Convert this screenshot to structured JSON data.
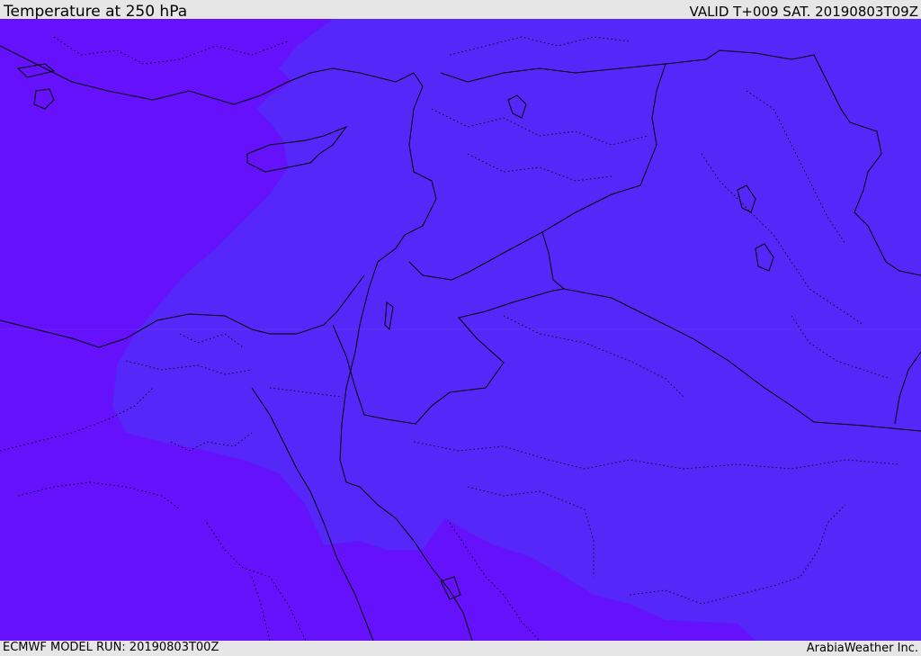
{
  "header": {
    "title": "Temperature at 250 hPa",
    "valid": "VALID T+009 SAT. 20190803T09Z"
  },
  "footer": {
    "model_run": "ECMWF MODEL RUN: 20190803T00Z",
    "credit": "ArabiaWeather Inc."
  },
  "colors": {
    "bar_bg": "#e6e6e6",
    "field_cold": "#6511fb",
    "field_warm": "#5527f9",
    "border": "#000000"
  },
  "legend_icons": {
    "coast": "solid-line",
    "admin": "dotted-line"
  }
}
